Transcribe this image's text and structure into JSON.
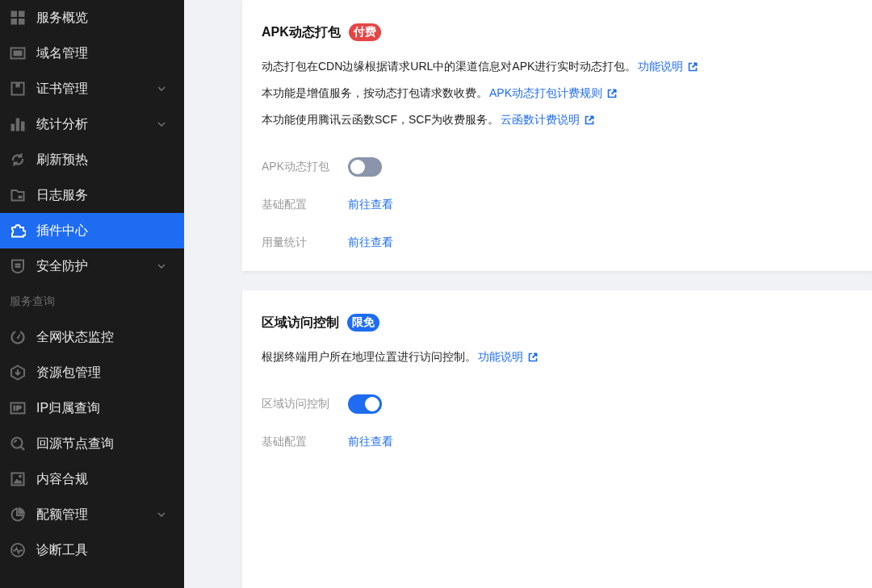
{
  "sidebar": {
    "items": [
      {
        "kind": "item",
        "label": "服务概览",
        "selected": false,
        "expandable": false
      },
      {
        "kind": "item",
        "label": "域名管理",
        "selected": false,
        "expandable": false
      },
      {
        "kind": "item",
        "label": "证书管理",
        "selected": false,
        "expandable": true
      },
      {
        "kind": "item",
        "label": "统计分析",
        "selected": false,
        "expandable": true
      },
      {
        "kind": "item",
        "label": "刷新预热",
        "selected": false,
        "expandable": false
      },
      {
        "kind": "item",
        "label": "日志服务",
        "selected": false,
        "expandable": false
      },
      {
        "kind": "item",
        "label": "插件中心",
        "selected": true,
        "expandable": false
      },
      {
        "kind": "item",
        "label": "安全防护",
        "selected": false,
        "expandable": true
      },
      {
        "kind": "section",
        "label": "服务查询"
      },
      {
        "kind": "item",
        "label": "全网状态监控",
        "selected": false,
        "expandable": false
      },
      {
        "kind": "item",
        "label": "资源包管理",
        "selected": false,
        "expandable": false
      },
      {
        "kind": "item",
        "label": "IP归属查询",
        "selected": false,
        "expandable": false
      },
      {
        "kind": "item",
        "label": "回源节点查询",
        "selected": false,
        "expandable": false
      },
      {
        "kind": "item",
        "label": "内容合规",
        "selected": false,
        "expandable": false
      },
      {
        "kind": "item",
        "label": "配额管理",
        "selected": false,
        "expandable": true
      },
      {
        "kind": "item",
        "label": "诊断工具",
        "selected": false,
        "expandable": false
      }
    ]
  },
  "cards": [
    {
      "title": "APK动态打包",
      "badge": {
        "text": "付费",
        "color": "#e54545"
      },
      "descriptions": [
        {
          "text": "动态打包在CDN边缘根据请求URL中的渠道信息对APK进行实时动态打包。",
          "link": "功能说明"
        },
        {
          "text": "本功能是增值服务，按动态打包请求数收费。",
          "link": "APK动态打包计费规则"
        },
        {
          "text": "本功能使用腾讯云函数SCF，SCF为收费服务。",
          "link": "云函数计费说明"
        }
      ],
      "settings": [
        {
          "kind": "toggle",
          "label": "APK动态打包",
          "on": false
        },
        {
          "kind": "link",
          "label": "基础配置",
          "link": "前往查看"
        },
        {
          "kind": "link",
          "label": "用量统计",
          "link": "前往查看"
        }
      ]
    },
    {
      "title": "区域访问控制",
      "badge": {
        "text": "限免",
        "color": "#1d6cf2"
      },
      "descriptions": [
        {
          "text": "根据终端用户所在地理位置进行访问控制。",
          "link": "功能说明"
        }
      ],
      "settings": [
        {
          "kind": "toggle",
          "label": "区域访问控制",
          "on": true
        },
        {
          "kind": "link",
          "label": "基础配置",
          "link": "前往查看"
        }
      ]
    }
  ]
}
